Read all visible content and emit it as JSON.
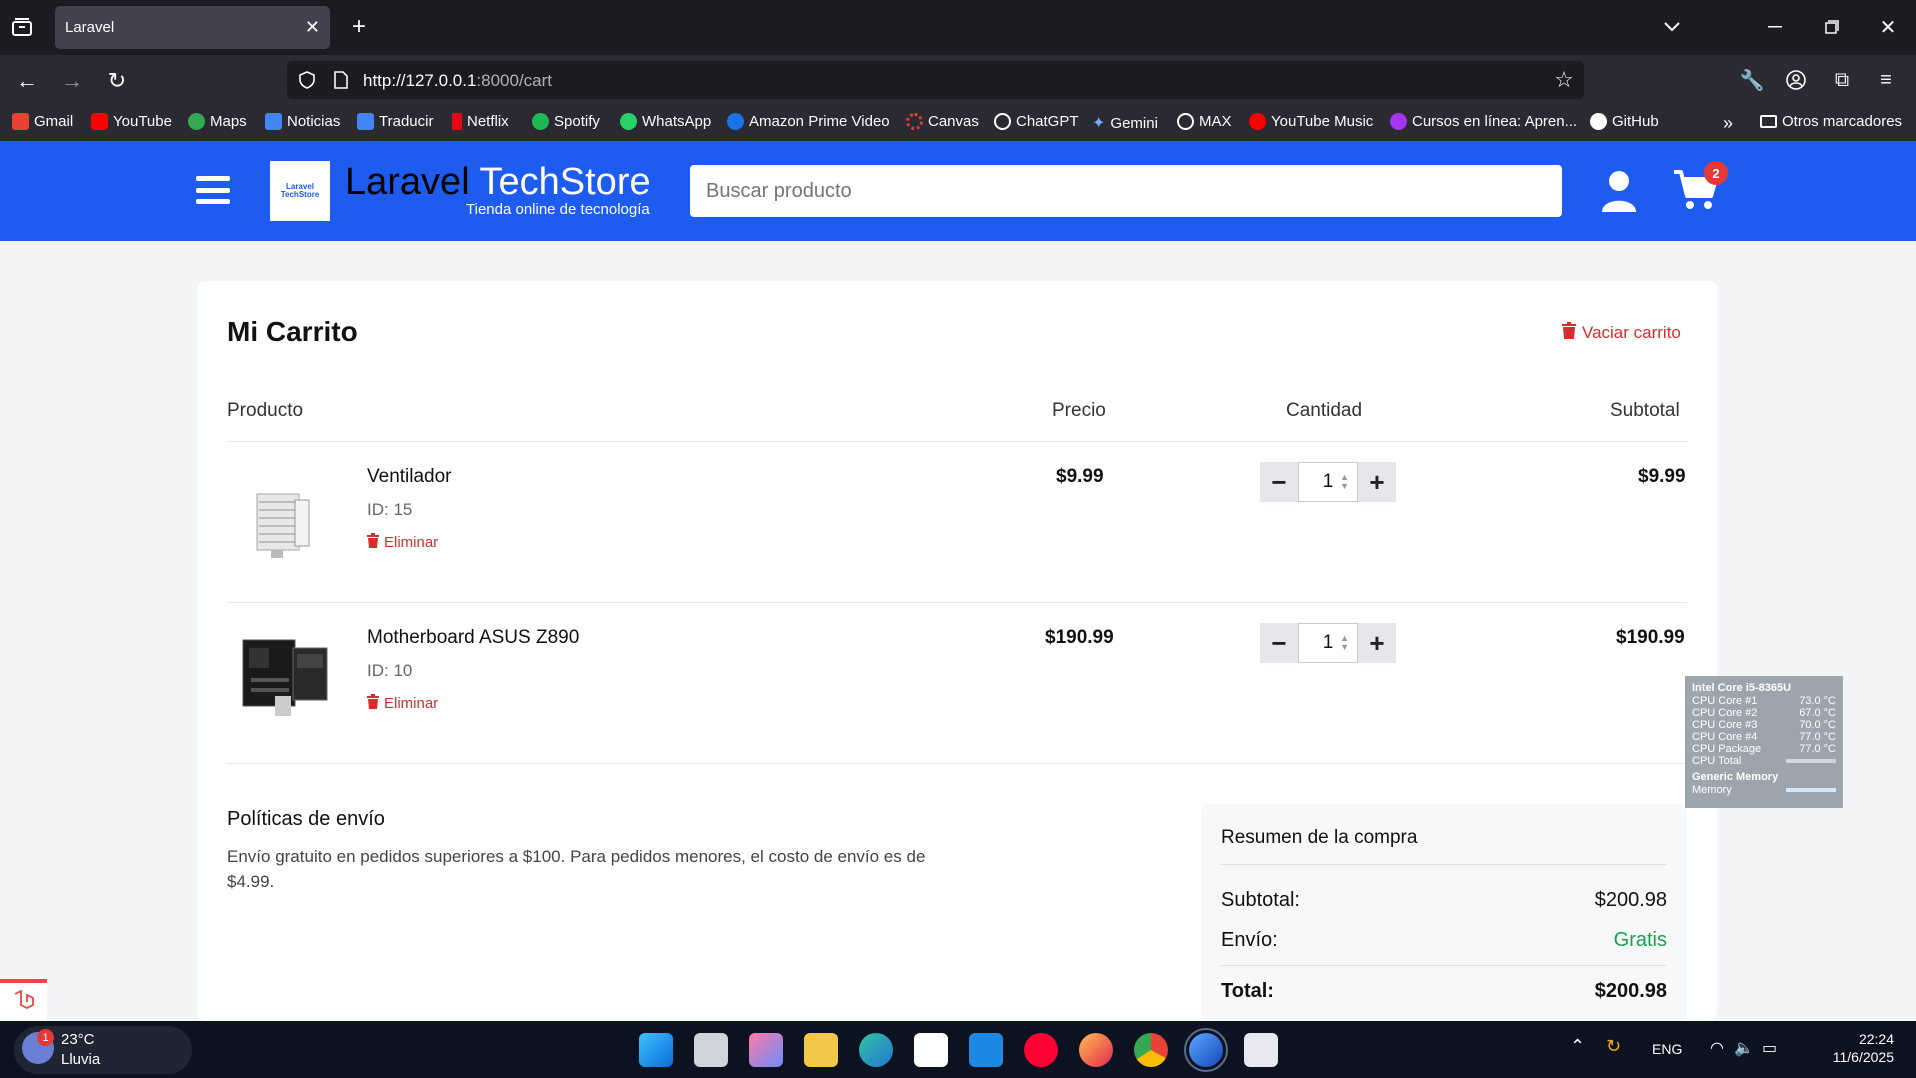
{
  "browser": {
    "tab_title": "Laravel",
    "url_host": "http://127.0.0.1",
    "url_rest": ":8000/cart",
    "bookmarks": [
      "Gmail",
      "YouTube",
      "Maps",
      "Noticias",
      "Traducir",
      "Netflix",
      "Spotify",
      "WhatsApp",
      "Amazon Prime Video",
      "Canvas",
      "ChatGPT",
      "Gemini",
      "MAX",
      "YouTube Music",
      "Cursos en línea: Apren...",
      "GitHub"
    ],
    "other_bookmarks": "Otros marcadores"
  },
  "header": {
    "logo_text": "Laravel TechStore",
    "brand_primary": "Laravel",
    "brand_accent": "TechStore",
    "tagline": "Tienda online de tecnología",
    "search_placeholder": "Buscar producto",
    "cart_count": "2",
    "brand_color": "#1e5cf0"
  },
  "cart": {
    "title": "Mi Carrito",
    "clear_label": "Vaciar carrito",
    "columns": [
      "Producto",
      "Precio",
      "Cantidad",
      "Subtotal"
    ],
    "items": [
      {
        "name": "Ventilador",
        "id_label": "ID: 15",
        "delete_label": "Eliminar",
        "price": "$9.99",
        "quantity": "1",
        "subtotal": "$9.99"
      },
      {
        "name": "Motherboard ASUS Z890",
        "id_label": "ID: 10",
        "delete_label": "Eliminar",
        "price": "$190.99",
        "quantity": "1",
        "subtotal": "$190.99"
      }
    ]
  },
  "policy": {
    "title": "Políticas de envío",
    "text": "Envío gratuito en pedidos superiores a $100. Para pedidos menores, el costo de envío es de $4.99."
  },
  "summary": {
    "title": "Resumen de la compra",
    "subtotal_label": "Subtotal:",
    "subtotal_value": "$200.98",
    "shipping_label": "Envío:",
    "shipping_value": "Gratis",
    "total_label": "Total:",
    "total_value": "$200.98"
  },
  "hw_widget": {
    "cpu_name": "Intel Core i5-8365U",
    "rows": [
      {
        "label": "CPU Core #1",
        "value": "73.0 °C"
      },
      {
        "label": "CPU Core #2",
        "value": "67.0 °C"
      },
      {
        "label": "CPU Core #3",
        "value": "70.0 °C"
      },
      {
        "label": "CPU Core #4",
        "value": "77.0 °C"
      },
      {
        "label": "CPU Package",
        "value": "77.0 °C"
      },
      {
        "label": "CPU Total",
        "value": ""
      }
    ],
    "mem_name": "Generic Memory",
    "mem_label": "Memory"
  },
  "taskbar": {
    "temp": "23°C",
    "weather": "Lluvia",
    "weather_badge": "1",
    "lang": "ENG",
    "time": "22:24",
    "date": "11/6/2025"
  }
}
